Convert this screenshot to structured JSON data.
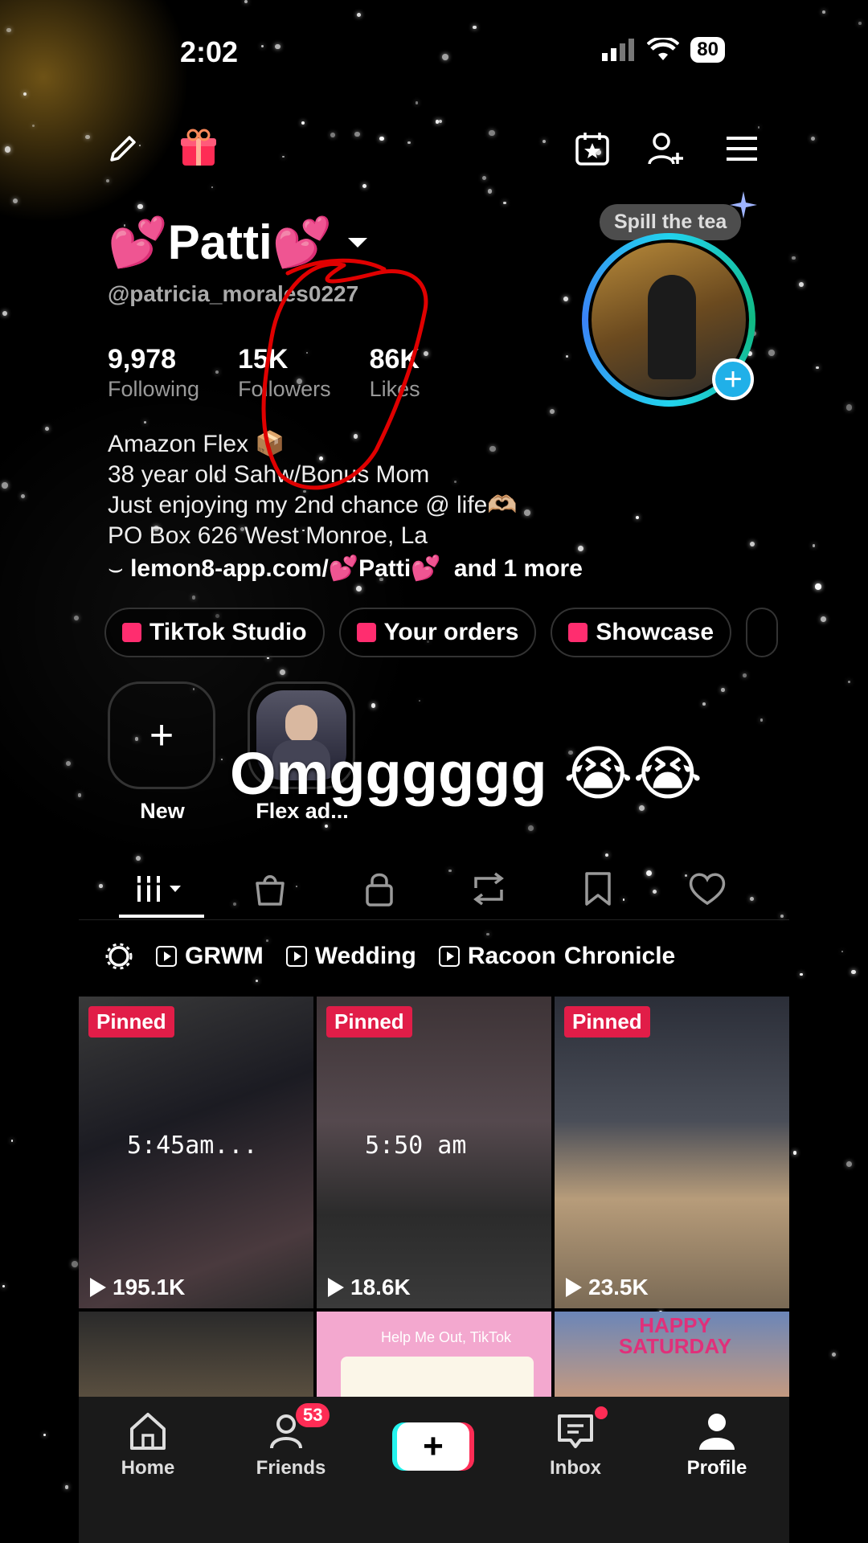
{
  "status": {
    "time": "2:02",
    "battery": "80"
  },
  "profile": {
    "name": "💕Patti💕",
    "handle": "@patricia_morales0227",
    "tooltip": "Spill the tea",
    "stats": [
      {
        "num": "9,978",
        "label": "Following"
      },
      {
        "num": "15K",
        "label": "Followers"
      },
      {
        "num": "86K",
        "label": "Likes"
      }
    ],
    "bio": [
      "Amazon Flex 📦",
      "38 year old Sahw/Bonus Mom",
      "Just enjoying my 2nd chance @ life🫶🏼",
      "PO Box 626 West Monroe, La"
    ],
    "link": "lemon8-app.com/💕Patti💕",
    "link_more": "and 1 more"
  },
  "pills": [
    {
      "label": "TikTok Studio"
    },
    {
      "label": "Your orders"
    },
    {
      "label": "Showcase"
    }
  ],
  "stories": [
    {
      "label": "New"
    },
    {
      "label": "Flex ad..."
    }
  ],
  "caption": "Omgggggg 😭😭",
  "categories": [
    "GRWM",
    "Wedding",
    "Racoon",
    "Chronicle"
  ],
  "videos": [
    {
      "pinned": "Pinned",
      "views": "195.1K",
      "overlay": "5:45am..."
    },
    {
      "pinned": "Pinned",
      "views": "18.6K",
      "overlay": "5:50 am"
    },
    {
      "pinned": "Pinned",
      "views": "23.5K",
      "overlay": ""
    },
    {
      "overlay": ""
    },
    {
      "overlay": "Help Me Out, TikTok"
    },
    {
      "overlay": "HAPPY SATURDAY"
    }
  ],
  "nav": {
    "home": "Home",
    "friends": "Friends",
    "friends_badge": "53",
    "inbox": "Inbox",
    "profile": "Profile"
  }
}
